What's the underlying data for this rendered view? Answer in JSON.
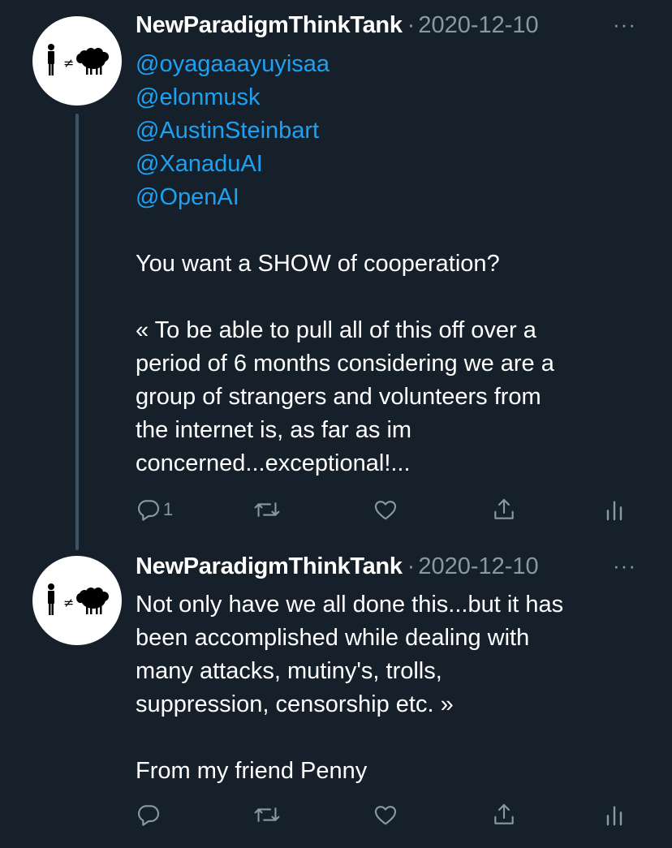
{
  "tweets": [
    {
      "author": "NewParadigmThinkTank",
      "separator": "·",
      "date": "2020-12-10",
      "more": "···",
      "mentions": [
        "@oyagaaayuyisaa",
        "@elonmusk",
        "@AustinSteinbart",
        "@XanaduAI",
        "@OpenAI"
      ],
      "text": "You want a SHOW of cooperation?\n\n« To be able to pull all of this off over a\nperiod of 6 months considering we are a\ngroup of strangers and volunteers from\nthe internet is, as far as im\nconcerned...exceptional!...",
      "reply_count": "1",
      "icons": [
        "reply-icon",
        "retweet-icon",
        "like-icon",
        "share-icon",
        "analytics-icon"
      ]
    },
    {
      "author": "NewParadigmThinkTank",
      "separator": "·",
      "date": "2020-12-10",
      "more": "···",
      "text": "Not only have we all done this...but it has\nbeen accomplished while dealing with\nmany attacks, mutiny's, trolls,\nsuppression, censorship etc. »\n\nFrom my friend Penny",
      "reply_count": "",
      "icons": [
        "reply-icon",
        "retweet-icon",
        "like-icon",
        "share-icon",
        "analytics-icon"
      ]
    }
  ],
  "colors": {
    "background": "#15202b",
    "text": "#ffffff",
    "secondary": "#8899a6",
    "link": "#1da1f2",
    "thread_line": "#3d5466"
  },
  "avatar": {
    "glyph": "≠",
    "icon_names": [
      "person-icon",
      "not-equal-icon",
      "sheep-icon"
    ]
  }
}
